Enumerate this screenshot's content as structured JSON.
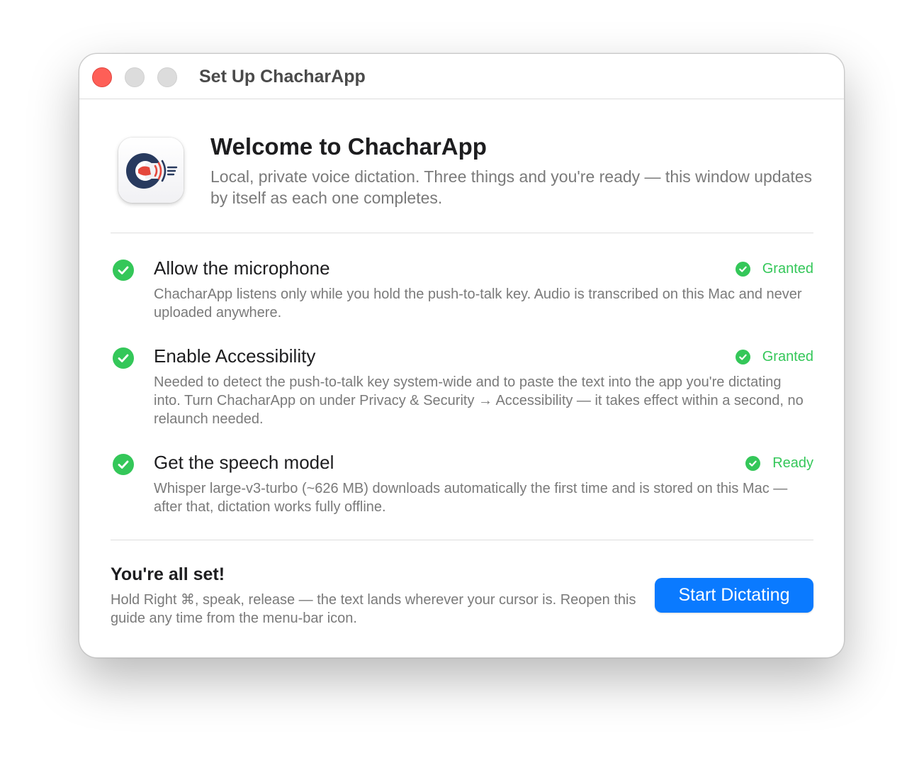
{
  "window": {
    "title": "Set Up ChacharApp"
  },
  "header": {
    "title": "Welcome to ChacharApp",
    "subtitle": "Local, private voice dictation. Three things and you're ready — this window updates by itself as each one completes."
  },
  "steps": [
    {
      "title": "Allow the microphone",
      "description": "ChacharApp listens only while you hold the push-to-talk key. Audio is transcribed on this Mac and never uploaded anywhere.",
      "status": "Granted",
      "completed": true
    },
    {
      "title": "Enable Accessibility",
      "description": "Needed to detect the push-to-talk key system-wide and to paste the text into the app you're dictating into. Turn ChacharApp on under Privacy & Security → Accessibility — it takes effect within a second, no relaunch needed.",
      "status": "Granted",
      "completed": true
    },
    {
      "title": "Get the speech model",
      "description": "Whisper large-v3-turbo (~626 MB) downloads automatically the first time and is stored on this Mac — after that, dictation works fully offline.",
      "status": "Ready",
      "completed": true
    }
  ],
  "footer": {
    "title": "You're all set!",
    "description": "Hold Right ⌘, speak, release — the text lands wherever your cursor is. Reopen this guide any time from the menu-bar icon.",
    "button_label": "Start Dictating"
  },
  "colors": {
    "accent": "#0a7aff",
    "success": "#34c759",
    "close": "#fe5f57",
    "icon_navy": "#283a5e",
    "icon_red": "#e5483c"
  },
  "icons": {
    "app": "chacharapp-app-icon",
    "step_check": "checkmark-circle-icon",
    "status": "checkmark-circle-icon"
  }
}
